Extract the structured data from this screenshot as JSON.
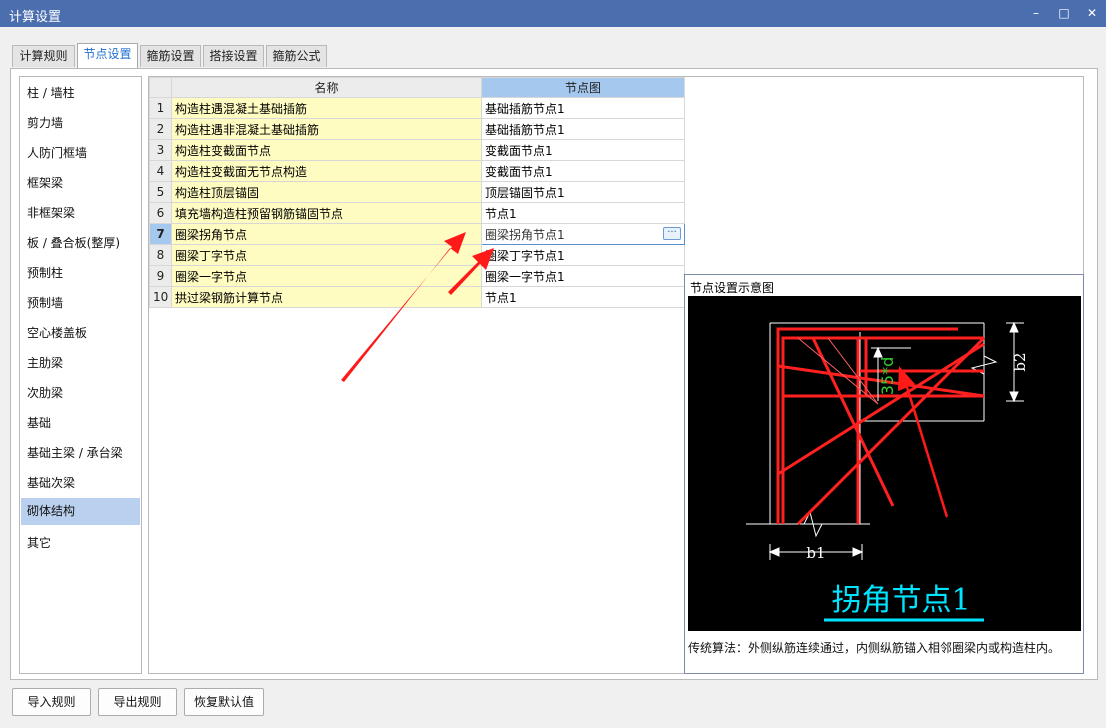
{
  "window": {
    "title": "计算设置"
  },
  "tabs": [
    {
      "label": "计算规则"
    },
    {
      "label": "节点设置",
      "active": true
    },
    {
      "label": "箍筋设置"
    },
    {
      "label": "搭接设置"
    },
    {
      "label": "箍筋公式"
    }
  ],
  "sidebar": {
    "items": [
      {
        "label": "柱 / 墙柱"
      },
      {
        "label": "剪力墙"
      },
      {
        "label": "人防门框墙"
      },
      {
        "label": "框架梁"
      },
      {
        "label": "非框架梁"
      },
      {
        "label": "板 / 叠合板(整厚)"
      },
      {
        "label": "预制柱"
      },
      {
        "label": "预制墙"
      },
      {
        "label": "空心楼盖板"
      },
      {
        "label": "主肋梁"
      },
      {
        "label": "次肋梁"
      },
      {
        "label": "基础"
      },
      {
        "label": "基础主梁 / 承台梁"
      },
      {
        "label": "基础次梁"
      },
      {
        "label": "砌体结构",
        "selected": true
      },
      {
        "label": "其它"
      }
    ]
  },
  "grid": {
    "columns": {
      "name": "名称",
      "node": "节点图"
    },
    "rows": [
      {
        "num": "1",
        "name": "构造柱遇混凝土基础插筋",
        "node": "基础插筋节点1"
      },
      {
        "num": "2",
        "name": "构造柱遇非混凝土基础插筋",
        "node": "基础插筋节点1"
      },
      {
        "num": "3",
        "name": "构造柱变截面节点",
        "node": "变截面节点1"
      },
      {
        "num": "4",
        "name": "构造柱变截面无节点构造",
        "node": "变截面节点1"
      },
      {
        "num": "5",
        "name": "构造柱顶层锚固",
        "node": "顶层锚固节点1"
      },
      {
        "num": "6",
        "name": "填充墙构造柱预留钢筋锚固节点",
        "node": "节点1"
      },
      {
        "num": "7",
        "name": "圈梁拐角节点",
        "node": "圈梁拐角节点1",
        "selected": true
      },
      {
        "num": "8",
        "name": "圈梁丁字节点",
        "node": "圈梁丁字节点1"
      },
      {
        "num": "9",
        "name": "圈梁一字节点",
        "node": "圈梁一字节点1"
      },
      {
        "num": "10",
        "name": "拱过梁钢筋计算节点",
        "node": "节点1"
      }
    ],
    "ellipsis": "···"
  },
  "preview": {
    "title": "节点设置示意图",
    "diagram": {
      "dim_anchor": "35*d",
      "dim_b1": "b1",
      "dim_b2": "b2",
      "caption": "拐角节点1"
    },
    "description": "传统算法：外侧纵筋连续通过，内侧纵筋锚入相邻圈梁内或构造柱内。"
  },
  "buttons": {
    "import": "导入规则",
    "export": "导出规则",
    "restore": "恢复默认值"
  },
  "window_controls": {
    "minimize": "–",
    "maximize": "□",
    "close": "✕"
  },
  "colors": {
    "titlebar": "#4b6eaf",
    "selected": "#b9d1ee",
    "name_cell": "#fffcc2",
    "rebar": "#ff1a1a",
    "caption": "#00e5ff"
  }
}
